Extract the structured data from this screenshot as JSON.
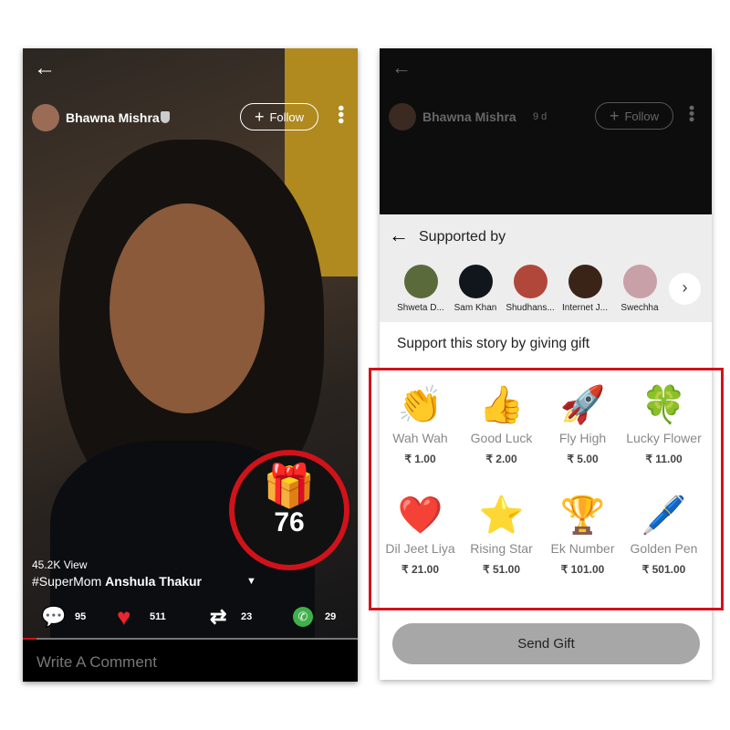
{
  "left": {
    "back_icon": "arrow-left",
    "author": "Bhawna Mishra",
    "follow_label": "Follow",
    "gift_count": "76",
    "views": "45.2K View",
    "hashtag": "#SuperMom",
    "title": "Anshula Thakur",
    "actions": [
      {
        "icon": "comment",
        "count": "95"
      },
      {
        "icon": "heart",
        "count": "511"
      },
      {
        "icon": "repost",
        "count": "23"
      },
      {
        "icon": "whatsapp",
        "count": "29"
      }
    ],
    "comment_placeholder": "Write A Comment"
  },
  "right": {
    "author": "Bhawna Mishra",
    "age": "9 d",
    "follow_label": "Follow",
    "supported_by_title": "Supported by",
    "supporters": [
      {
        "name": "Shweta D...",
        "color": "#5a6a3a"
      },
      {
        "name": "Sam Khan",
        "color": "#10161c"
      },
      {
        "name": "Shudhans...",
        "color": "#b0473a"
      },
      {
        "name": "Internet J...",
        "color": "#3a2418"
      },
      {
        "name": "Swechha",
        "color": "#c7a0a8"
      }
    ],
    "gift_prompt": "Support this story by giving gift",
    "gifts": [
      {
        "name": "Wah Wah",
        "price": "₹ 1.00",
        "icon": "👏"
      },
      {
        "name": "Good Luck",
        "price": "₹ 2.00",
        "icon": "👍"
      },
      {
        "name": "Fly High",
        "price": "₹ 5.00",
        "icon": "🚀"
      },
      {
        "name": "Lucky Flower",
        "price": "₹ 11.00",
        "icon": "🍀"
      },
      {
        "name": "Dil Jeet Liya",
        "price": "₹ 21.00",
        "icon": "❤️"
      },
      {
        "name": "Rising Star",
        "price": "₹ 51.00",
        "icon": "⭐"
      },
      {
        "name": "Ek Number",
        "price": "₹ 101.00",
        "icon": "🏆"
      },
      {
        "name": "Golden Pen",
        "price": "₹ 501.00",
        "icon": "🖊️"
      }
    ],
    "send_label": "Send Gift"
  },
  "colors": {
    "highlight": "#d0121b",
    "heart": "#e8262f",
    "whatsapp": "#3fb04a",
    "send_button": "#a7a7a7"
  }
}
